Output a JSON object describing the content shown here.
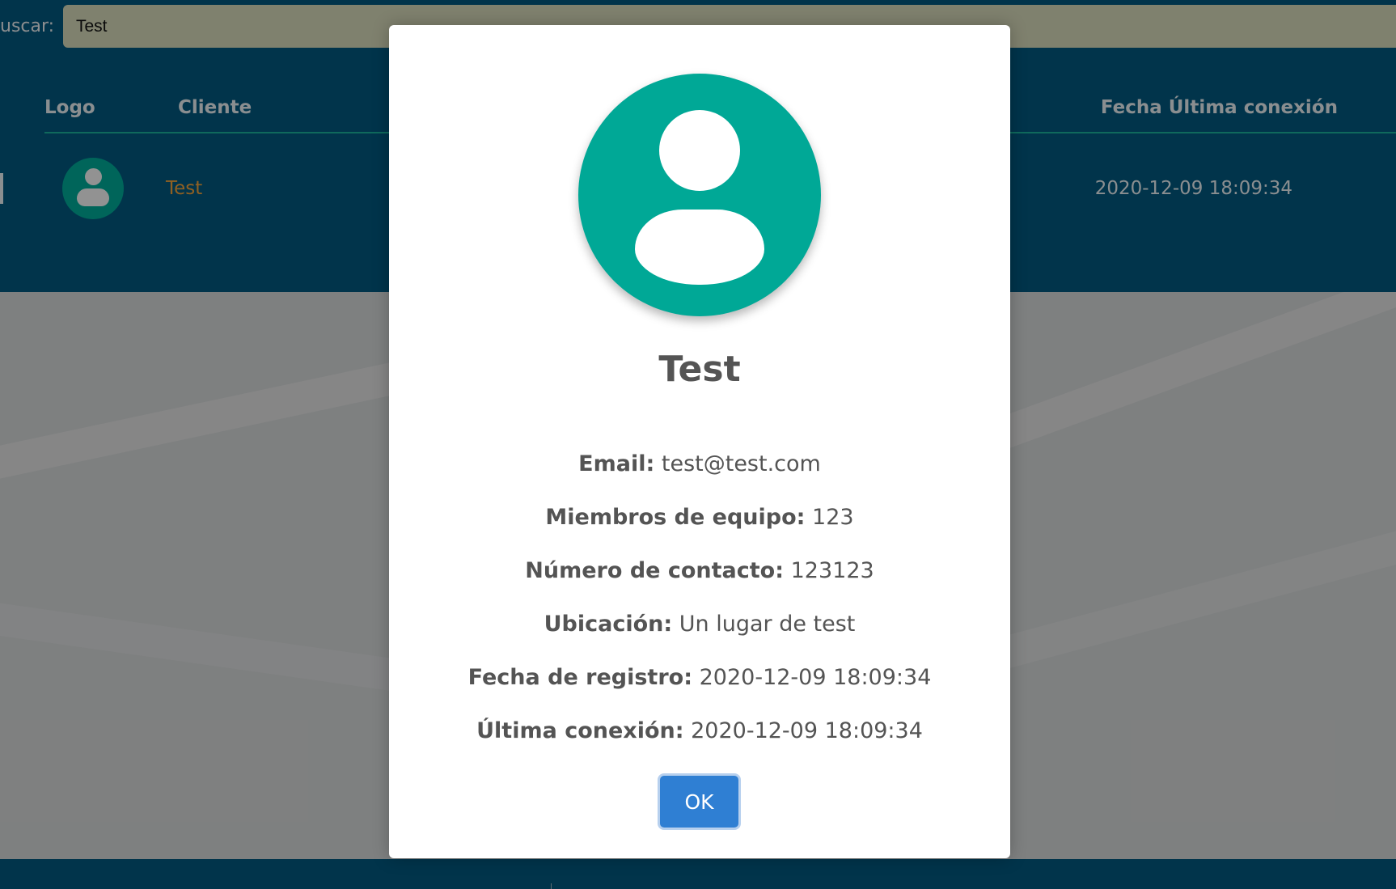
{
  "search": {
    "label": "uscar:",
    "value": "Test"
  },
  "table": {
    "headers": {
      "logo": "Logo",
      "cliente": "Cliente",
      "fecha_ultima_conexion": "Fecha Última conexión"
    },
    "rows": [
      {
        "avatar_icon": "user-avatar-icon",
        "cliente": "Test",
        "fecha_ultima_conexion": "2020-12-09 18:09:34"
      }
    ]
  },
  "modal": {
    "avatar_icon": "user-avatar-icon",
    "title": "Test",
    "fields": [
      {
        "label": "Email:",
        "value": "test@test.com"
      },
      {
        "label": "Miembros de equipo:",
        "value": "123"
      },
      {
        "label": "Número de contacto:",
        "value": "123123"
      },
      {
        "label": "Ubicación:",
        "value": "Un lugar de test"
      },
      {
        "label": "Fecha de registro:",
        "value": "2020-12-09 18:09:34"
      },
      {
        "label": "Última conexión:",
        "value": "2020-12-09 18:09:34"
      }
    ],
    "ok_label": "OK"
  },
  "colors": {
    "header_bg": "#03577d",
    "accent_teal": "#00a896",
    "cliente_link": "#f0a13a",
    "ok_button": "#2f7fd3",
    "modal_text": "#545454"
  }
}
